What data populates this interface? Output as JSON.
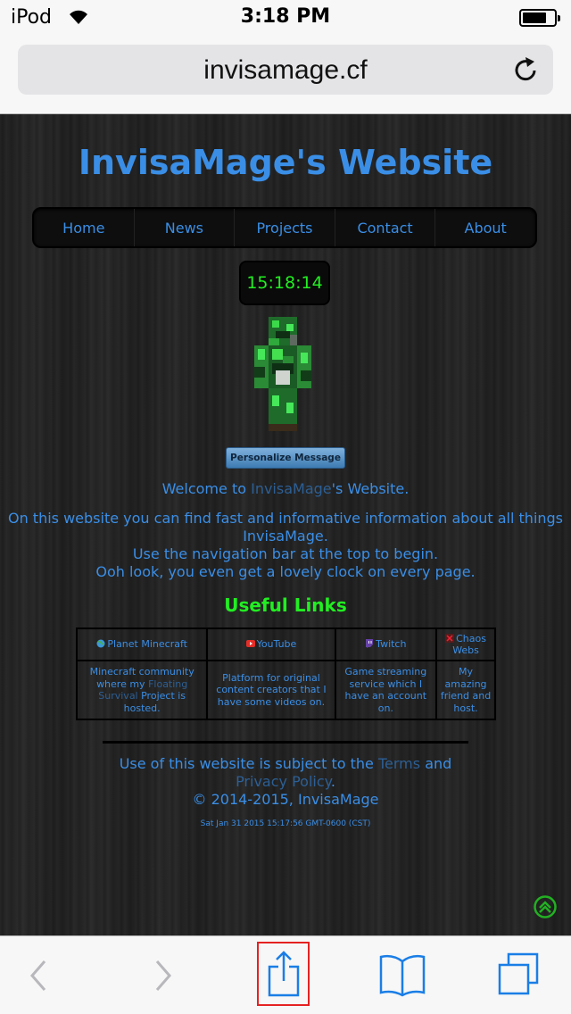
{
  "status_bar": {
    "carrier": "iPod",
    "time": "3:18 PM"
  },
  "address_bar": {
    "url": "invisamage.cf"
  },
  "site": {
    "title": "InvisaMage's Website",
    "nav": [
      "Home",
      "News",
      "Projects",
      "Contact",
      "About"
    ],
    "clock": "15:18:14",
    "personalize_button": "Personalize Message",
    "welcome": {
      "pre": "Welcome to ",
      "link": "InvisaMage",
      "post": "'s Website."
    },
    "info_lines": [
      "On this website you can find fast and informative information about all things",
      "InvisaMage.",
      "Use the navigation bar at the top to begin.",
      "Ooh look, you even get a lovely clock on every page."
    ],
    "useful_links_title": "Useful Links",
    "links": [
      {
        "name": "Planet Minecraft",
        "icon": "globe-icon",
        "desc_pre": "Minecraft community where my ",
        "desc_link": "Floating Survival",
        "desc_post": " Project is hosted."
      },
      {
        "name": "YouTube",
        "icon": "youtube-icon",
        "desc_pre": "Platform for original content creators that I have some videos on.",
        "desc_link": "",
        "desc_post": ""
      },
      {
        "name": "Twitch",
        "icon": "twitch-icon",
        "desc_pre": "Game streaming service which I have an account on.",
        "desc_link": "",
        "desc_post": ""
      },
      {
        "name": "Chaos Webs",
        "icon": "chaos-webs-icon",
        "desc_pre": "My amazing friend and host.",
        "desc_link": "",
        "desc_post": ""
      }
    ],
    "footer": {
      "line1_pre": "Use of this website is subject to the ",
      "terms": "Terms",
      "and": " and",
      "privacy": "Privacy Policy",
      "dot": ".",
      "copyright": "© 2014-2015, InvisaMage",
      "timestamp": "Sat Jan 31 2015 15:17:56 GMT-0600 (CST)"
    }
  },
  "colors": {
    "link_blue": "#3a8ee6",
    "clock_green": "#22ee22",
    "ios_blue": "#1a7ee6"
  },
  "toolbar": {
    "icons": [
      "back-arrow-icon",
      "forward-arrow-icon",
      "share-icon",
      "bookmarks-icon",
      "tabs-icon"
    ]
  }
}
